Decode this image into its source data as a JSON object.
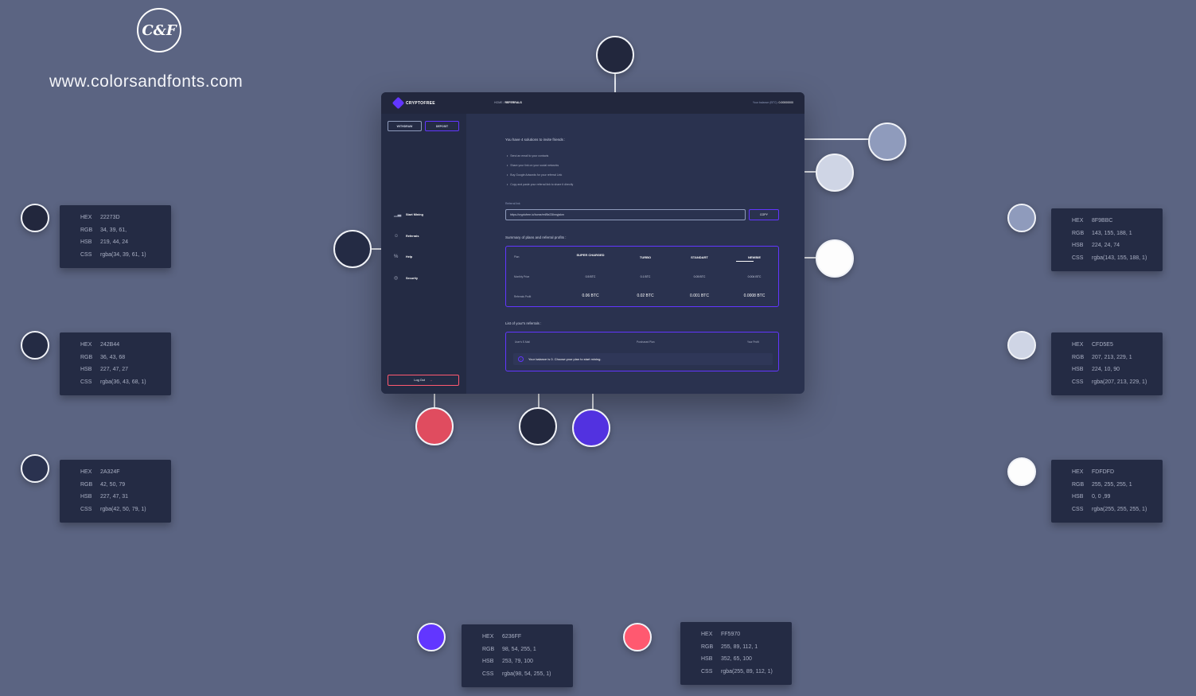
{
  "brand": {
    "logo_text": "C&F",
    "url": "www.colorsandfonts.com"
  },
  "app": {
    "name": "CRYPTOFREE",
    "breadcrumb_home": "HOME /",
    "breadcrumb_current": "REFERRALS",
    "balance_label": "Your balance (BTC):",
    "balance_value": "0.00000000",
    "withdraw_label": "WITHDRAW",
    "deposit_label": "DEPOSIT",
    "menu": [
      {
        "label": "Start Mining",
        "icon": "chart-icon"
      },
      {
        "label": "Referrals",
        "icon": "users-icon"
      },
      {
        "label": "Help",
        "icon": "percent-icon"
      },
      {
        "label": "Security",
        "icon": "globe-icon"
      }
    ],
    "logout_label": "Log Out",
    "invite_title": "You have 4 solutions to invite friends :",
    "invite_options": [
      "Send an email to your contacts",
      "Share your link on your social networks",
      "Buy Google Adwords for your referral Link",
      "Copy and paste your referral link to share it directly"
    ],
    "referral_link_label": "Referral link",
    "referral_link_value": "https://cryptofree.io/home/ref/8e23llnnyjakm",
    "copy_label": "COPY",
    "summary_title": "Summary of plans and referral profits :",
    "plans_header": [
      "Plan",
      "SUPER CHARGED",
      "TURBO",
      "STANDART",
      "NEWBIE"
    ],
    "plans_rows": [
      {
        "label": "Monthly Price",
        "values": [
          "0.5 BTC",
          "0.1 BTC",
          "0.05 BTC",
          "0.004 BTC"
        ]
      },
      {
        "label": "Referrals Profit",
        "values": [
          "0.06 BTC",
          "0.02 BTC",
          "0.001 BTC",
          "0.0008 BTC"
        ]
      }
    ],
    "list_title": "List of your's referrals :",
    "list_columns": [
      "User's E-Mail",
      "Purchased Plan",
      "Your Profit"
    ],
    "notice_text": "Your balance is 0. Choose your plan to start mining."
  },
  "colors": [
    {
      "hex": "22273D",
      "rgb": "34, 39, 61,",
      "hsb": "219, 44, 24",
      "css": "rgba(34, 39, 61, 1)",
      "swatch": "#22273d"
    },
    {
      "hex": "242B44",
      "rgb": "36, 43, 68",
      "hsb": "227, 47, 27",
      "css": "rgba(36, 43, 68, 1)",
      "swatch": "#242b44"
    },
    {
      "hex": "2A324F",
      "rgb": "42, 50, 79",
      "hsb": "227, 47, 31",
      "css": "rgba(42, 50, 79, 1)",
      "swatch": "#2a324f"
    },
    {
      "hex": "8F9BBC",
      "rgb": "143, 155, 188, 1",
      "hsb": "224, 24, 74",
      "css": "rgba(143, 155, 188, 1)",
      "swatch": "#8f9bbc"
    },
    {
      "hex": "CFD5E5",
      "rgb": "207, 213, 229, 1",
      "hsb": "224, 10, 90",
      "css": "rgba(207, 213, 229, 1)",
      "swatch": "#cfd5e5"
    },
    {
      "hex": "FDFDFD",
      "rgb": "255, 255, 255, 1",
      "hsb": "0, 0 ,99",
      "css": "rgba(255, 255, 255, 1)",
      "swatch": "#fdfdfd"
    },
    {
      "hex": "6236FF",
      "rgb": "98, 54, 255, 1",
      "hsb": "253, 79, 100",
      "css": "rgba(98, 54, 255, 1)",
      "swatch": "#6236ff"
    },
    {
      "hex": "FF5970",
      "rgb": "255, 89, 112, 1",
      "hsb": "352, 65, 100",
      "css": "rgba(255, 89, 112, 1)",
      "swatch": "#ff5970"
    }
  ],
  "card_keys": {
    "hex": "HEX",
    "rgb": "RGB",
    "hsb": "HSB",
    "css": "CSS"
  },
  "page_background": "#5b6482",
  "accent": "#6236ff",
  "danger": "#ff5970"
}
